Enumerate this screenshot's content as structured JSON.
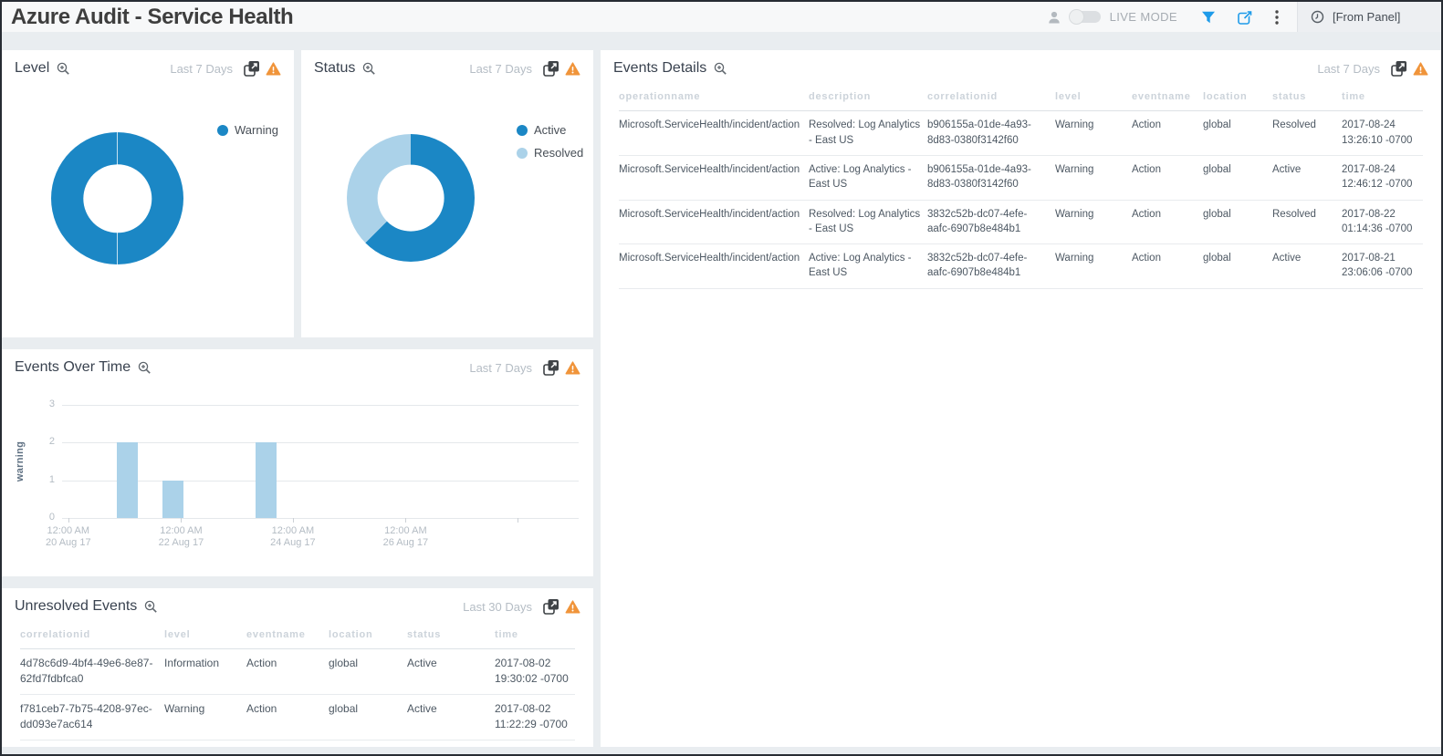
{
  "header": {
    "title": "Azure Audit - Service Health",
    "live_mode_label": "LIVE MODE",
    "from_panel_label": "[From Panel]"
  },
  "colors": {
    "primary_blue": "#1b87c5",
    "light_blue": "#abd2e9",
    "warning_orange": "#f0943a",
    "icon_blue": "#1e9be9",
    "panel_bg": "#ffffff",
    "dashboard_bg": "#e9edf0"
  },
  "panels": {
    "level": {
      "title": "Level",
      "time_range": "Last 7 Days",
      "legend": [
        {
          "label": "Warning",
          "color": "#1b87c5"
        }
      ]
    },
    "status": {
      "title": "Status",
      "time_range": "Last 7 Days",
      "legend": [
        {
          "label": "Active",
          "color": "#1b87c5"
        },
        {
          "label": "Resolved",
          "color": "#abd2e9"
        }
      ]
    },
    "events_details": {
      "title": "Events Details",
      "time_range": "Last 7 Days",
      "table": {
        "columns": [
          "operationname",
          "description",
          "correlationid",
          "level",
          "eventname",
          "location",
          "status",
          "time"
        ],
        "rows": [
          [
            "Microsoft.ServiceHealth/incident/action",
            "Resolved: Log Analytics - East US",
            "b906155a-01de-4a93-8d83-0380f3142f60",
            "Warning",
            "Action",
            "global",
            "Resolved",
            "2017-08-24 13:26:10 -0700"
          ],
          [
            "Microsoft.ServiceHealth/incident/action",
            "Active: Log Analytics - East US",
            "b906155a-01de-4a93-8d83-0380f3142f60",
            "Warning",
            "Action",
            "global",
            "Active",
            "2017-08-24 12:46:12 -0700"
          ],
          [
            "Microsoft.ServiceHealth/incident/action",
            "Resolved: Log Analytics - East US",
            "3832c52b-dc07-4efe-aafc-6907b8e484b1",
            "Warning",
            "Action",
            "global",
            "Resolved",
            "2017-08-22 01:14:36 -0700"
          ],
          [
            "Microsoft.ServiceHealth/incident/action",
            "Active: Log Analytics - East US",
            "3832c52b-dc07-4efe-aafc-6907b8e484b1",
            "Warning",
            "Action",
            "global",
            "Active",
            "2017-08-21 23:06:06 -0700"
          ]
        ]
      }
    },
    "events_over_time": {
      "title": "Events Over Time",
      "time_range": "Last 7 Days"
    },
    "unresolved_events": {
      "title": "Unresolved Events",
      "time_range": "Last 30 Days",
      "table": {
        "columns": [
          "correlationid",
          "level",
          "eventname",
          "location",
          "status",
          "time"
        ],
        "rows": [
          [
            "4d78c6d9-4bf4-49e6-8e87-62fd7fdbfca0",
            "Information",
            "Action",
            "global",
            "Active",
            "2017-08-02 19:30:02 -0700"
          ],
          [
            "f781ceb7-7b75-4208-97ec-dd093e7ac614",
            "Warning",
            "Action",
            "global",
            "Active",
            "2017-08-02 11:22:29 -0700"
          ]
        ]
      }
    }
  },
  "chart_data": [
    {
      "id": "level",
      "type": "pie",
      "title": "Level",
      "labels": [
        "Warning"
      ],
      "values": [
        100
      ],
      "colors": [
        "#1b87c5"
      ],
      "donut": true,
      "legend_position": "right"
    },
    {
      "id": "status",
      "type": "pie",
      "title": "Status",
      "labels": [
        "Active",
        "Resolved"
      ],
      "values": [
        62.5,
        37.5
      ],
      "colors": [
        "#1b87c5",
        "#abd2e9"
      ],
      "donut": true,
      "legend_position": "right"
    },
    {
      "id": "events_over_time",
      "type": "bar",
      "title": "Events Over Time",
      "ylabel": "warning",
      "ylim": [
        0,
        3
      ],
      "yticks": [
        0,
        1,
        2,
        3
      ],
      "grid": true,
      "bar_color": "#abd2e9",
      "x_ticks": [
        {
          "frac": 0.012,
          "line1": "12:00 AM",
          "line2": "20 Aug 17"
        },
        {
          "frac": 0.2305,
          "line1": "12:00 AM",
          "line2": "22 Aug 17"
        },
        {
          "frac": 0.4468,
          "line1": "12:00 AM",
          "line2": "24 Aug 17"
        },
        {
          "frac": 0.665,
          "line1": "12:00 AM",
          "line2": "26 Aug 17"
        },
        {
          "frac": 0.881,
          "line1": "",
          "line2": ""
        }
      ],
      "bars": [
        {
          "x": "21 Aug 17",
          "frac": 0.126,
          "value": 2
        },
        {
          "x": "22 Aug 17",
          "frac": 0.215,
          "value": 1
        },
        {
          "x": "24 Aug 17",
          "frac": 0.394,
          "value": 2
        }
      ]
    }
  ]
}
